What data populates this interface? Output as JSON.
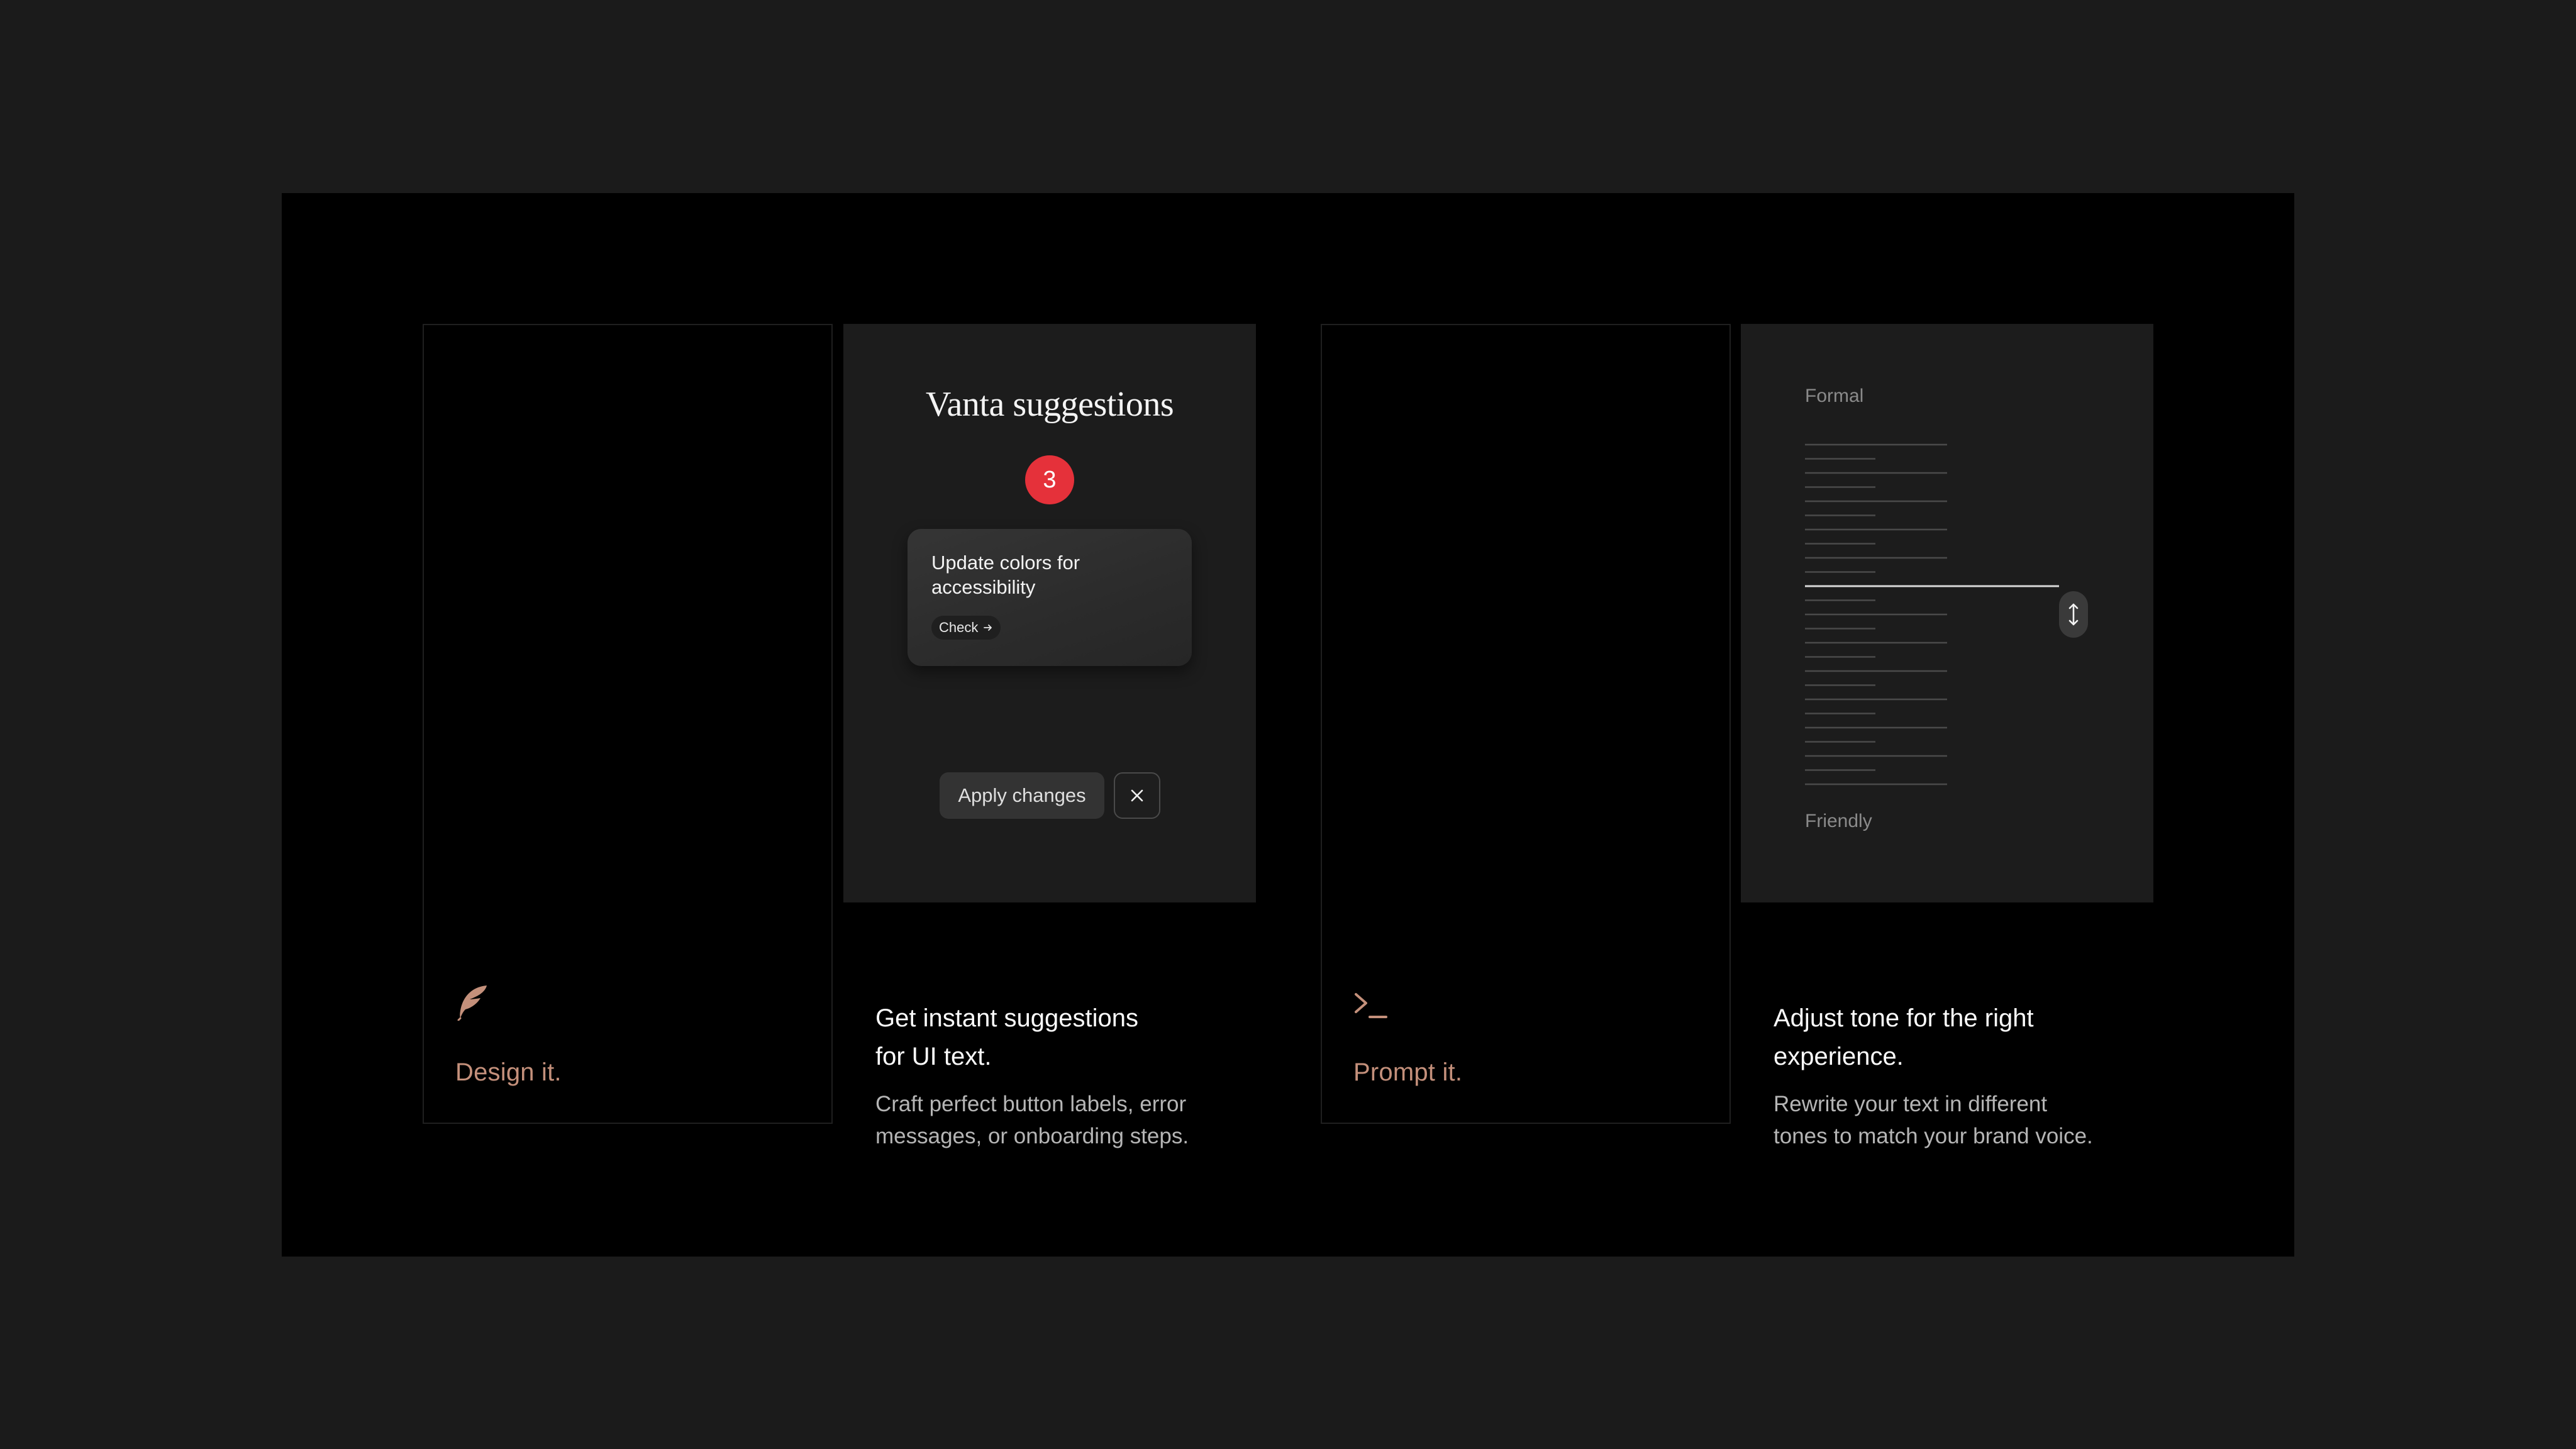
{
  "cards": {
    "design": {
      "label": "Design it.",
      "icon": "feather-icon"
    },
    "suggestions": {
      "title": "Vanta suggestions",
      "badge_count": "3",
      "suggestion_text": "Update colors for accessibility",
      "check_label": "Check",
      "apply_label": "Apply changes",
      "heading_line1": "Get instant suggestions",
      "heading_line2": "for UI text.",
      "desc_line1": "Craft perfect button labels, error",
      "desc_line2": "messages, or onboarding steps."
    },
    "prompt": {
      "label": "Prompt it.",
      "icon": "terminal-prompt-icon"
    },
    "tone": {
      "top_label": "Formal",
      "bottom_label": "Friendly",
      "slider_level": 0.43,
      "heading_line1": "Adjust tone for the right",
      "heading_line2": "experience.",
      "desc_line1": "Rewrite your text in different",
      "desc_line2": "tones to match your brand voice."
    }
  },
  "colors": {
    "accent": "#c4907b",
    "badge": "#e5313a",
    "background": "#1b1b1b",
    "frame": "#000000",
    "panel": "#1c1c1c"
  }
}
